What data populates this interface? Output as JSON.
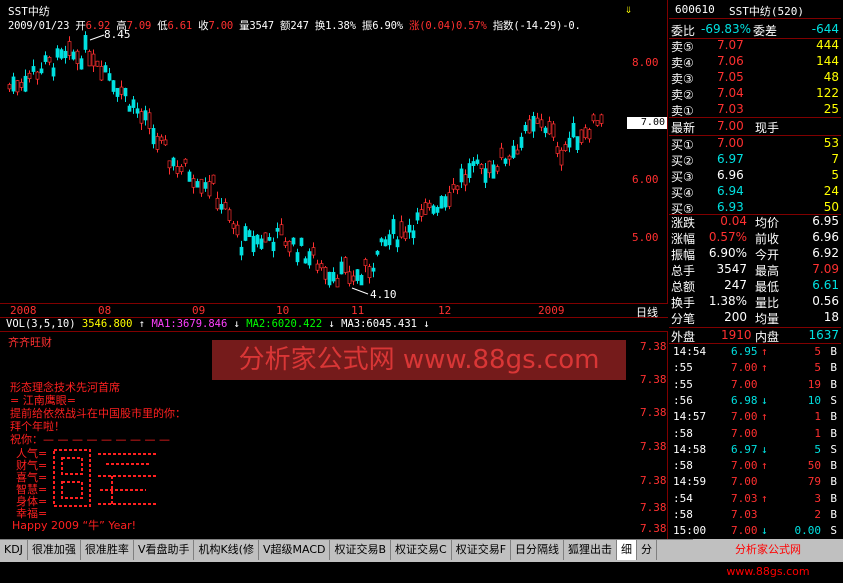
{
  "stock": {
    "name": "SST中纺",
    "code": "600610",
    "panel_title": "SST中纺(520)"
  },
  "ohlc": {
    "date": "2009/01/23",
    "open_label": "开",
    "open": "6.92",
    "high_label": "高",
    "high": "7.09",
    "low_label": "低",
    "low": "6.61",
    "close_label": "收",
    "close": "7.00",
    "vol_label": "量",
    "vol": "3547",
    "amt_label": "额",
    "amt": "247",
    "turn_label": "换",
    "turn": "1.38%",
    "amp_label": "振",
    "amp": "6.90%",
    "chg_label": "涨",
    "chg": "(0.04)",
    "chg_pct": "0.57%",
    "index_label": "指数",
    "index": "(-14.29)-0."
  },
  "price_ticks": [
    "8.00",
    "7.00",
    "6.00",
    "5.00"
  ],
  "current_price_tag": "7.00",
  "max_label": "8.45",
  "min_label": "4.10",
  "date_axis": [
    "2008",
    "08",
    "09",
    "10",
    "11",
    "12",
    "2009"
  ],
  "period_label": "日线",
  "volume_line": {
    "title": "VOL(3,5,10)",
    "value": "3546.800",
    "ma1": "MA1:3679.846",
    "ma2": "MA2:6020.422",
    "ma3": "MA3:6045.431"
  },
  "formula": {
    "name": "齐齐旺财",
    "ticks": [
      "7.38",
      "7.38",
      "7.38",
      "7.38",
      "7.38",
      "7.38",
      "7.38"
    ],
    "watermark": "分析家公式网 www.88gs.com",
    "messages": [
      "形态理念技术先河首席",
      "= 江南鹰眼=",
      "提前给依然战斗在中国股市里的你：",
      "拜个年啦！",
      "祝你：— — — — — — — — —",
      "人气=",
      "财气=",
      "喜气=",
      "智慧=",
      "身体=",
      "幸福=",
      "Happy 2009 “牛” Year!"
    ]
  },
  "order_book": {
    "ratio_label": "委比",
    "ratio": "-69.83%",
    "diff_label": "委差",
    "diff": "-644",
    "sells": [
      {
        "label": "卖⑤",
        "price": "7.07",
        "vol": "444"
      },
      {
        "label": "卖④",
        "price": "7.06",
        "vol": "144"
      },
      {
        "label": "卖③",
        "price": "7.05",
        "vol": "48"
      },
      {
        "label": "卖②",
        "price": "7.04",
        "vol": "122"
      },
      {
        "label": "卖①",
        "price": "7.03",
        "vol": "25"
      }
    ],
    "last_label": "最新",
    "last": "7.00",
    "hand_label": "现手",
    "buys": [
      {
        "label": "买①",
        "price": "7.00",
        "vol": "53"
      },
      {
        "label": "买②",
        "price": "6.97",
        "vol": "7"
      },
      {
        "label": "买③",
        "price": "6.96",
        "vol": "5"
      },
      {
        "label": "买④",
        "price": "6.94",
        "vol": "24"
      },
      {
        "label": "买⑤",
        "price": "6.93",
        "vol": "50"
      }
    ]
  },
  "stats": [
    {
      "l1": "涨跌",
      "v1": "0.04",
      "l2": "均价",
      "v2": "6.95"
    },
    {
      "l1": "涨幅",
      "v1": "0.57%",
      "l2": "前收",
      "v2": "6.96"
    },
    {
      "l1": "振幅",
      "v1": "6.90%",
      "l2": "今开",
      "v2": "6.92"
    },
    {
      "l1": "总手",
      "v1": "3547",
      "l2": "最高",
      "v2": "7.09"
    },
    {
      "l1": "总额",
      "v1": "247",
      "l2": "最低",
      "v2": "6.61"
    },
    {
      "l1": "换手",
      "v1": "1.38%",
      "l2": "量比",
      "v2": "0.56"
    },
    {
      "l1": "分笔",
      "v1": "200",
      "l2": "均量",
      "v2": "18"
    }
  ],
  "outer_inner": {
    "outer_label": "外盘",
    "outer": "1910",
    "inner_label": "内盘",
    "inner": "1637"
  },
  "ticks": [
    {
      "time": "14:54",
      "price": "6.95",
      "arrow": "↑",
      "vol": "5",
      "side": "B"
    },
    {
      "time": ":55",
      "price": "7.00",
      "arrow": "↑",
      "vol": "5",
      "side": "B"
    },
    {
      "time": ":55",
      "price": "7.00",
      "arrow": "",
      "vol": "19",
      "side": "B"
    },
    {
      "time": ":56",
      "price": "6.98",
      "arrow": "↓",
      "vol": "10",
      "side": "S"
    },
    {
      "time": "14:57",
      "price": "7.00",
      "arrow": "↑",
      "vol": "1",
      "side": "B"
    },
    {
      "time": ":58",
      "price": "7.00",
      "arrow": "",
      "vol": "1",
      "side": "B"
    },
    {
      "time": "14:58",
      "price": "6.97",
      "arrow": "↓",
      "vol": "5",
      "side": "S"
    },
    {
      "time": ":58",
      "price": "7.00",
      "arrow": "↑",
      "vol": "50",
      "side": "B"
    },
    {
      "time": "14:59",
      "price": "7.00",
      "arrow": "",
      "vol": "79",
      "side": "B"
    },
    {
      "time": ":54",
      "price": "7.03",
      "arrow": "↑",
      "vol": "3",
      "side": "B"
    },
    {
      "time": ":58",
      "price": "7.03",
      "arrow": "",
      "vol": "2",
      "side": "B"
    },
    {
      "time": "15:00",
      "price": "7.00",
      "arrow": "↓",
      "vol": "0.00",
      "side": "S"
    }
  ],
  "tabs": [
    "KDJ",
    "很准加强",
    "很准胜率",
    "V看盘助手",
    "机构K线(修",
    "V超级MACD",
    "权证交易B",
    "权证交易C",
    "权证交易F",
    "日分隔线",
    "狐狸出击",
    "细",
    "分"
  ],
  "footer_logo": "分析家公式网 www.88gs.com",
  "colors": {
    "up": "#ff3030",
    "down": "#00e0e0",
    "frame": "#800000",
    "price": "#ffff00"
  }
}
